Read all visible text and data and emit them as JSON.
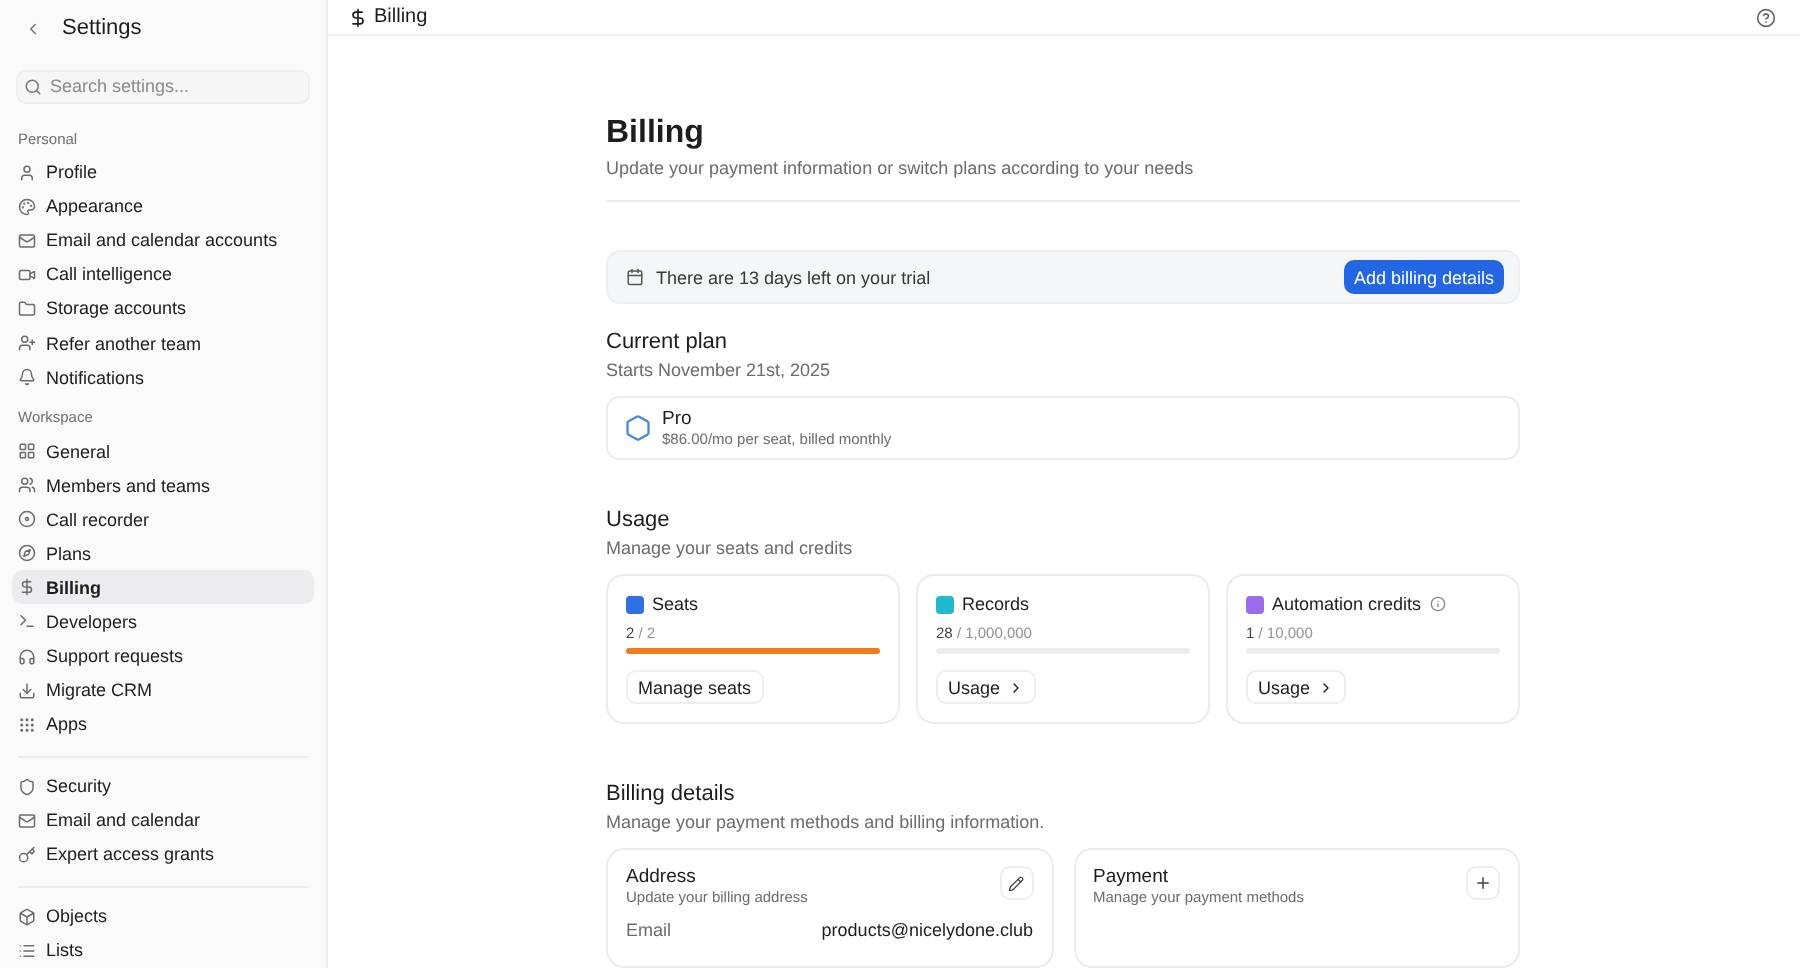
{
  "sidebar": {
    "title": "Settings",
    "search": {
      "placeholder": "Search settings..."
    },
    "groups": [
      {
        "label": "Personal",
        "items": [
          {
            "label": "Profile",
            "selected": false
          },
          {
            "label": "Appearance",
            "selected": false
          },
          {
            "label": "Email and calendar accounts",
            "selected": false
          },
          {
            "label": "Call intelligence",
            "selected": false
          },
          {
            "label": "Storage accounts",
            "selected": false
          },
          {
            "label": "Refer another team",
            "selected": false
          },
          {
            "label": "Notifications",
            "selected": false
          }
        ]
      },
      {
        "label": "Workspace",
        "items": [
          {
            "label": "General",
            "selected": false
          },
          {
            "label": "Members and teams",
            "selected": false
          },
          {
            "label": "Call recorder",
            "selected": false
          },
          {
            "label": "Plans",
            "selected": false
          },
          {
            "label": "Billing",
            "selected": true
          },
          {
            "label": "Developers",
            "selected": false
          },
          {
            "label": "Support requests",
            "selected": false
          },
          {
            "label": "Migrate CRM",
            "selected": false
          },
          {
            "label": "Apps",
            "selected": false
          }
        ]
      },
      {
        "items": [
          {
            "label": "Security",
            "selected": false
          },
          {
            "label": "Email and calendar",
            "selected": false
          },
          {
            "label": "Expert access grants",
            "selected": false
          }
        ]
      },
      {
        "items": [
          {
            "label": "Objects",
            "selected": false
          },
          {
            "label": "Lists",
            "selected": false
          }
        ]
      }
    ]
  },
  "header": {
    "title": "Billing"
  },
  "page": {
    "title": "Billing",
    "subtitle": "Update your payment information or switch plans according to your needs",
    "trial": {
      "text": "There are 13 days left on your trial",
      "button": "Add billing details"
    },
    "current_plan": {
      "title": "Current plan",
      "subtitle": "Starts November 21st, 2025",
      "plan": {
        "name": "Pro",
        "price": "$86.00/mo per seat, billed monthly"
      }
    },
    "usage": {
      "title": "Usage",
      "subtitle": "Manage your seats and credits",
      "cards": [
        {
          "name": "Seats",
          "color": "#2f6fe4",
          "used": "2",
          "total": "/ 2",
          "level": 1,
          "action": "Manage seats",
          "kind": "plain",
          "info": false
        },
        {
          "name": "Records",
          "color": "#22b8cf",
          "used": "28",
          "total": "/ 1,000,000",
          "level": 0,
          "action": "Usage",
          "kind": "chevron",
          "info": false
        },
        {
          "name": "Automation credits",
          "color": "#9b6cf0",
          "used": "1",
          "total": "/ 10,000",
          "level": 0,
          "action": "Usage",
          "kind": "chevron",
          "info": true
        }
      ]
    },
    "billing_details": {
      "title": "Billing details",
      "subtitle": "Manage your payment methods and billing information.",
      "cards": [
        {
          "title": "Address",
          "subtitle": "Update your billing address",
          "kind": "edit",
          "fields": [
            {
              "label": "Email",
              "value": "products@nicelydone.club"
            }
          ]
        },
        {
          "title": "Payment",
          "subtitle": "Manage your payment methods",
          "kind": "add"
        }
      ]
    }
  }
}
